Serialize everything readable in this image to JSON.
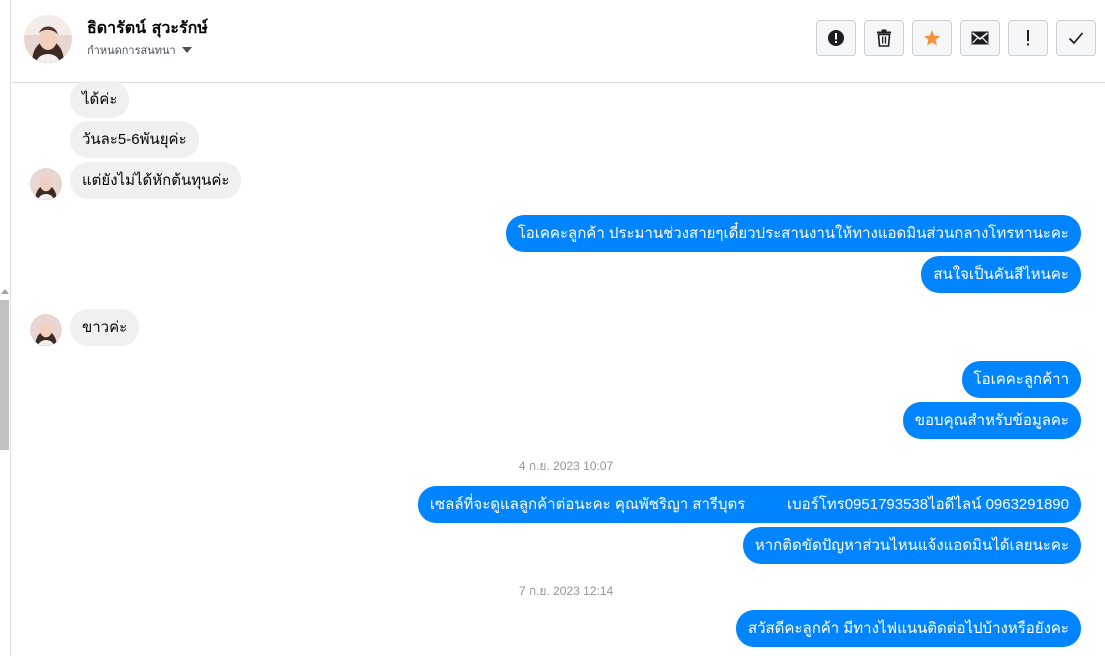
{
  "header": {
    "contact_name": "ธิดารัตน์ สุวะรักษ์",
    "subtitle": "กำหนดการสนทนา"
  },
  "toolbar": {
    "buttons": [
      {
        "icon": "alert-circle-icon"
      },
      {
        "icon": "trash-icon"
      },
      {
        "icon": "star-icon",
        "color": "#f7923b"
      },
      {
        "icon": "envelope-icon"
      },
      {
        "icon": "exclamation-icon"
      },
      {
        "icon": "checkmark-icon"
      }
    ]
  },
  "messages": [
    {
      "from": "customer",
      "text": "ได้ค่ะ"
    },
    {
      "from": "customer",
      "text": "วันละ5-6พันยุค่ะ"
    },
    {
      "from": "customer",
      "text": "แต่ยังไม่ได้หักต้นทุนค่ะ"
    },
    {
      "from": "page",
      "text": "โอเคคะลูกค้า ประมานช่วงสายๆเดี๋ยวประสานงานให้ทางแอดมินส่วนกลางโทรหานะคะ"
    },
    {
      "from": "page",
      "text": "สนใจเป็นคันสีไหนคะ"
    },
    {
      "from": "customer",
      "text": "ขาวค่ะ"
    },
    {
      "from": "page",
      "text": "โอเคคะลูกค้าา"
    },
    {
      "from": "page",
      "text": "ขอบคุณสำหรับข้อมูลคะ"
    },
    {
      "timestamp": "4 ก.ย. 2023 10:07"
    },
    {
      "from": "page",
      "text": "เซลล์ที่จะดูแลลูกค้าต่อนะคะ คุณพัชริญา สารีบุตร          เบอร์โทร0951793538ไอดีไลน์ 0963291890"
    },
    {
      "from": "page",
      "text": "หากติดขัดปัญหาส่วนไหนแจ้งแอดมินได้เลยนะคะ"
    },
    {
      "timestamp": "7 ก.ย. 2023 12:14"
    },
    {
      "from": "page",
      "text": "สวัสดีคะลูกค้า มีทางไฟแนนติดต่อไปบ้างหรือยังคะ"
    }
  ],
  "colors": {
    "outgoing_bubble": "#0084ff",
    "incoming_bubble": "#f0f0f0",
    "star": "#f7923b"
  }
}
